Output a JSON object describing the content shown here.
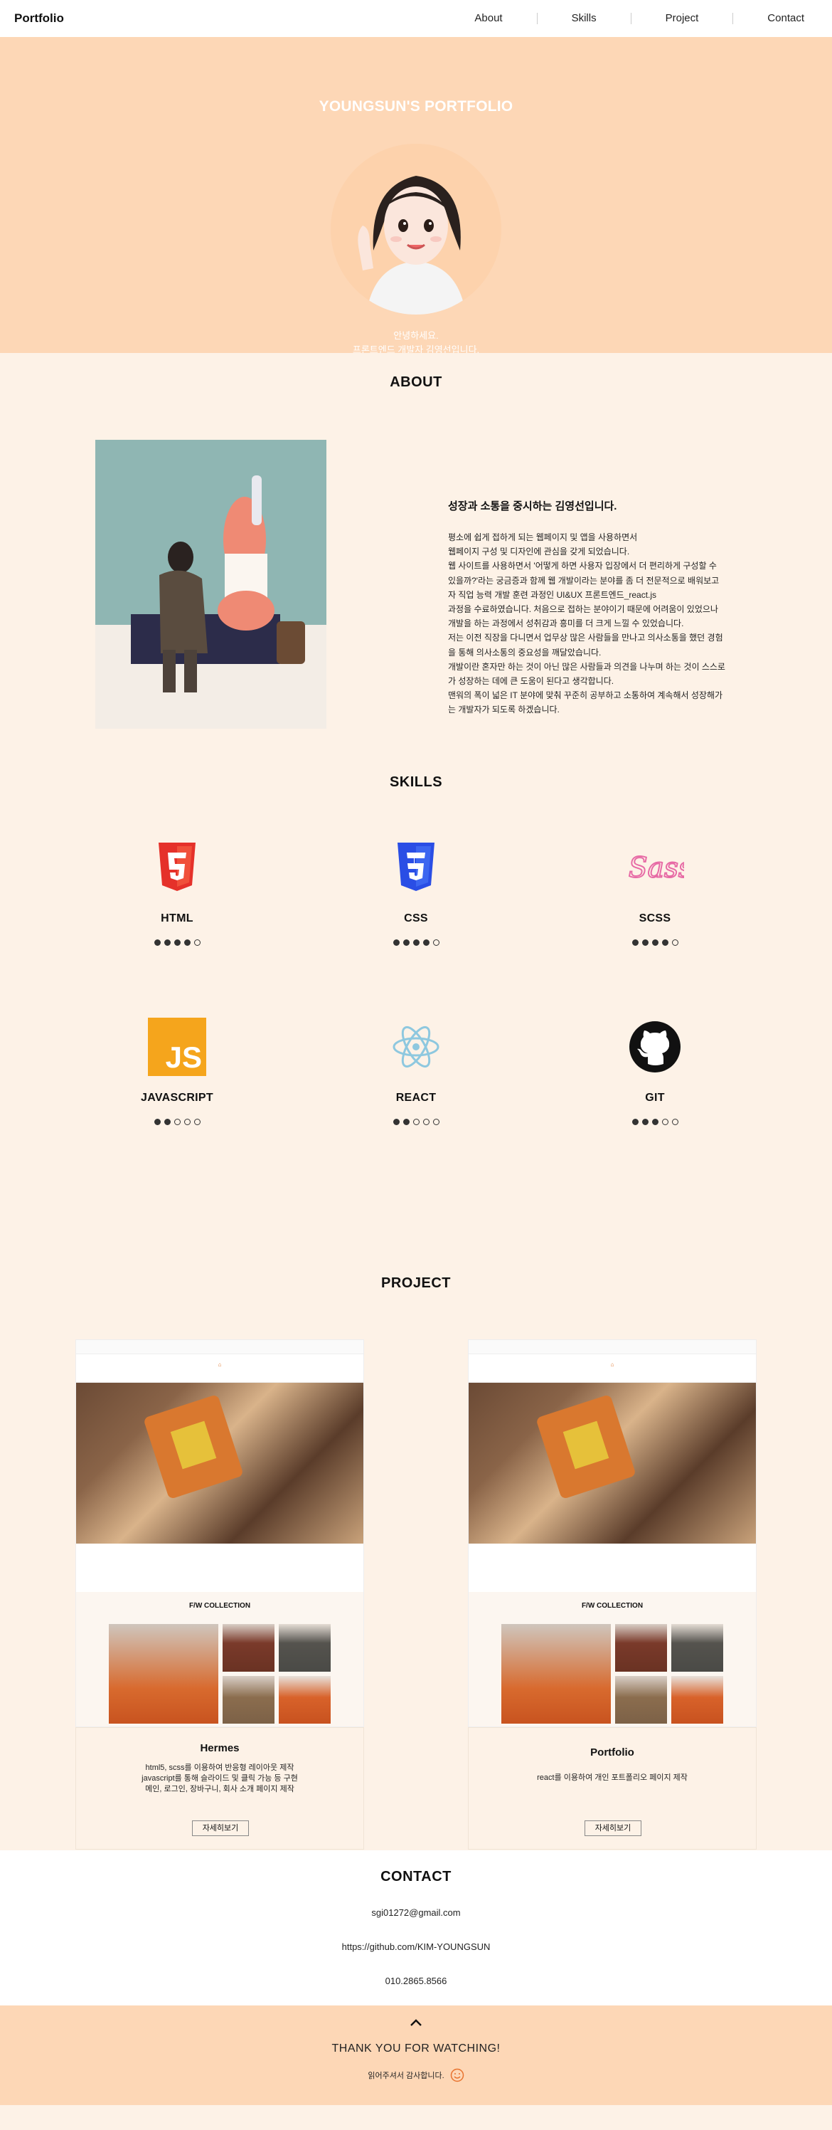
{
  "nav": {
    "brand": "Portfolio",
    "items": [
      "About",
      "Skills",
      "Project",
      "Contact"
    ]
  },
  "hero": {
    "title": "YOUNGSUN'S PORTFOLIO",
    "greeting_1": "안녕하세요.",
    "greeting_2": "프론트엔드 개발자 김영선입니다."
  },
  "about": {
    "title": "ABOUT",
    "heading": "성장과 소통을 중시하는 김영선입니다.",
    "body": "평소에 쉽게 접하게 되는 웹페이지 및 앱을 사용하면서\n웹페이지 구성 및 디자인에 관심을 갖게 되었습니다.\n웹 사이트를 사용하면서 '어떻게 하면 사용자 입장에서 더 편리하게 구성할 수\n있을까?'라는 궁금증과 함께 웹 개발이라는 분야를 좀 더 전문적으로 배워보고\n자 직업 능력 개발 훈련 과정인 UI&UX 프론트엔드_react.js\n과정을 수료하였습니다. 처음으로 접하는 분야이기 때문에 어려움이 있었으나\n개발을 하는 과정에서 성취감과 흥미를 더 크게 느낄 수 있었습니다.\n저는 이전 직장을 다니면서 업무상 많은 사람들을 만나고 의사소통을 했던 경험\n을 통해 의사소통의 중요성을 깨달았습니다.\n개발이란 혼자만 하는 것이 아닌 많은 사람들과 의견을 나누며 하는 것이 스스로\n가 성장하는 데에 큰 도움이 된다고 생각합니다.\n맨워의 폭이 넓은 IT 분야에 맞춰 꾸준히 공부하고 소통하여 계속해서 성장해가\n는 개발자가 되도록 하겠습니다."
  },
  "skills": {
    "title": "SKILLS",
    "items": [
      {
        "name": "HTML",
        "level": 4,
        "max": 5,
        "icon": "html5-icon",
        "color": "#e5312a"
      },
      {
        "name": "CSS",
        "level": 4,
        "max": 5,
        "icon": "css3-icon",
        "color": "#2a4ee5"
      },
      {
        "name": "SCSS",
        "level": 4,
        "max": 5,
        "icon": "sass-icon",
        "color": "#e76aa5"
      },
      {
        "name": "JAVASCRIPT",
        "level": 2,
        "max": 5,
        "icon": "javascript-icon",
        "color": "#f5a51c",
        "icon_text": "JS"
      },
      {
        "name": "REACT",
        "level": 2,
        "max": 5,
        "icon": "react-icon",
        "color": "#8ec8df"
      },
      {
        "name": "GIT",
        "level": 3,
        "max": 5,
        "icon": "github-icon",
        "color": "#111111"
      }
    ]
  },
  "project": {
    "title": "PROJECT",
    "collection_label": "F/W COLLECTION",
    "cards": [
      {
        "name": "Hermes",
        "desc": "html5, scss를 이용하여 반응형 레이아웃 제작\njavascript를 통해 슬라이드 및 클릭 가능 등 구현\n메인, 로그인, 장바구니, 회사 소개 페이지 제작",
        "button": "자세히보기"
      },
      {
        "name": "Portfolio",
        "desc": "react를 이용하여 개인 포트폴리오 페이지 제작",
        "button": "자세히보기"
      }
    ]
  },
  "contact": {
    "title": "CONTACT",
    "email": "sgi01272@gmail.com",
    "github": "https://github.com/KIM-YOUNGSUN",
    "phone": "010.2865.8566"
  },
  "footer": {
    "thanks": "THANK YOU FOR WATCHING!",
    "note": "읽어주셔서 감사합니다."
  },
  "colors": {
    "peach": "#fdd7b6",
    "cream": "#fdf2e7",
    "accent": "#e8732f"
  }
}
